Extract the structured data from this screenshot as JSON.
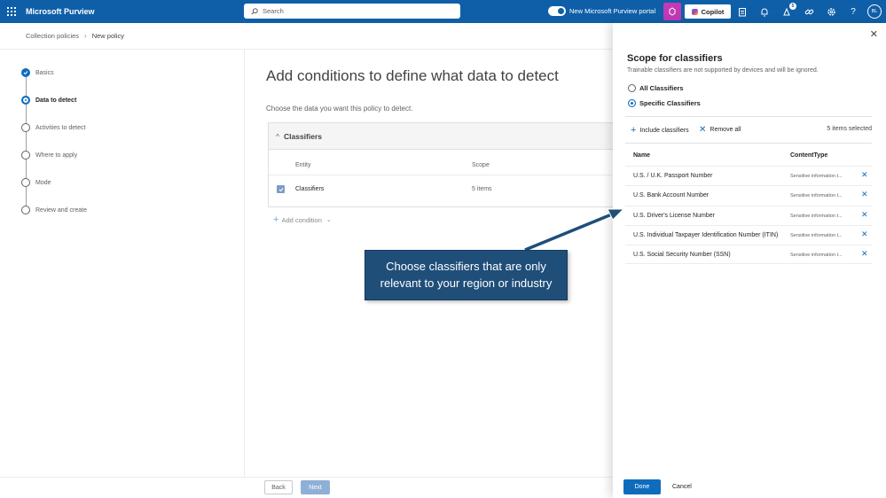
{
  "topbar": {
    "app_title": "Microsoft Purview",
    "search_placeholder": "Search",
    "portal_toggle_label": "New Microsoft Purview portal",
    "copilot_label": "Copilot",
    "notification_count": "5",
    "avatar_initials": "BL",
    "brand_color": "#0f5fa8"
  },
  "breadcrumb": {
    "parent": "Collection policies",
    "current": "New policy"
  },
  "stepper": {
    "steps": [
      {
        "label": "Basics",
        "state": "done"
      },
      {
        "label": "Data to detect",
        "state": "current"
      },
      {
        "label": "Activities to detect",
        "state": "pending"
      },
      {
        "label": "Where to apply",
        "state": "pending"
      },
      {
        "label": "Mode",
        "state": "pending"
      },
      {
        "label": "Review and create",
        "state": "pending"
      }
    ]
  },
  "main": {
    "title": "Add conditions to define what data to detect",
    "subtitle": "Choose the data you want this policy to detect.",
    "panel_title": "Classifiers",
    "col_entity": "Entity",
    "col_scope": "Scope",
    "row_entity": "Classifiers",
    "row_scope": "5 items",
    "add_condition": "Add condition"
  },
  "footer": {
    "back": "Back",
    "next": "Next"
  },
  "flyout": {
    "title": "Scope for classifiers",
    "description": "Trainable classifiers are not supported by devices and will be ignored.",
    "radio_all": "All Classifiers",
    "radio_specific": "Specific Classifiers",
    "include_label": "Include classifiers",
    "remove_all_label": "Remove all",
    "selected_count": "5 items selected",
    "col_name": "Name",
    "col_type": "ContentType",
    "rows": [
      {
        "name": "U.S. / U.K. Passport Number",
        "type": "Sensitive information t..."
      },
      {
        "name": "U.S. Bank Account Number",
        "type": "Sensitive information t..."
      },
      {
        "name": "U.S. Driver's License Number",
        "type": "Sensitive information t..."
      },
      {
        "name": "U.S. Individual Taxpayer Identification Number (ITIN)",
        "type": "Sensitive information t..."
      },
      {
        "name": "U.S. Social Security Number (SSN)",
        "type": "Sensitive information t..."
      }
    ],
    "done": "Done",
    "cancel": "Cancel"
  },
  "callout": {
    "text": "Choose classifiers that are only relevant to your region or industry",
    "color": "#1f4e79"
  }
}
